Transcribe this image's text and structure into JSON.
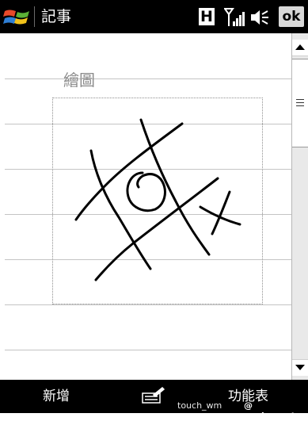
{
  "titlebar": {
    "app_title": "記事",
    "h_indicator": "H",
    "ok_label": "ok",
    "icons": [
      "windows-start-icon",
      "signal-icon",
      "volume-icon"
    ]
  },
  "note": {
    "drawing_label": "繪圖",
    "sketch_description": "tic-tac-toe grid with an O and an X"
  },
  "bottombar": {
    "left_softkey": "新增",
    "right_softkey": "功能表",
    "input_icon": "input-panel-icon",
    "watermark_user": "touch_wm",
    "watermark_site": "@ sogi.com.tw"
  }
}
